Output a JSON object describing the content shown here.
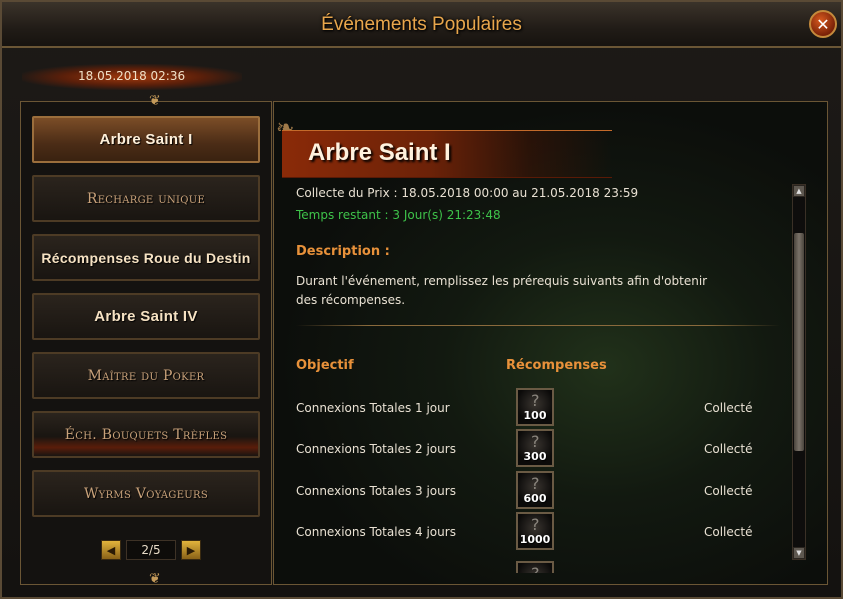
{
  "window": {
    "title": "Événements Populaires",
    "close_icon": "close-icon"
  },
  "server_time": "18.05.2018 02:36",
  "sidebar": {
    "items": [
      {
        "label": "Arbre Saint I",
        "active": true
      },
      {
        "label": "Recharge unique",
        "active": false
      },
      {
        "label": "Récompenses Roue du Destin",
        "active": false
      },
      {
        "label": "Arbre Saint IV",
        "active": false
      },
      {
        "label": "Maître du Poker",
        "active": false
      },
      {
        "label": "Éch. Bouquets Trèfles",
        "active": false
      },
      {
        "label": "Wyrms Voyageurs",
        "active": false
      }
    ],
    "pager": {
      "text": "2/5",
      "prev_icon": "arrow-left-icon",
      "next_icon": "arrow-right-icon"
    }
  },
  "event": {
    "title": "Arbre Saint I",
    "period": "Collecte du Prix : 18.05.2018 00:00 au 21.05.2018 23:59",
    "remaining": "Temps restant : 3 Jour(s)  21:23:48",
    "description_heading": "Description :",
    "description_text": "Durant l'événement, remplissez les prérequis suivants afin d'obtenir des récompenses.",
    "objective_header": "Objectif",
    "rewards_header": "Récompenses",
    "rows": [
      {
        "objective": "Connexions Totales 1 jour",
        "reward_amount": "100",
        "status": "Collecté"
      },
      {
        "objective": "Connexions Totales 2 jours",
        "reward_amount": "300",
        "status": "Collecté"
      },
      {
        "objective": "Connexions Totales 3 jours",
        "reward_amount": "600",
        "status": "Collecté"
      },
      {
        "objective": "Connexions Totales 4 jours",
        "reward_amount": "1000",
        "status": "Collecté"
      }
    ]
  },
  "colors": {
    "title": "#e8a64c",
    "heading_orange": "#e8913a",
    "remaining_green": "#3ec34a",
    "active_button": "#7b4d27"
  }
}
